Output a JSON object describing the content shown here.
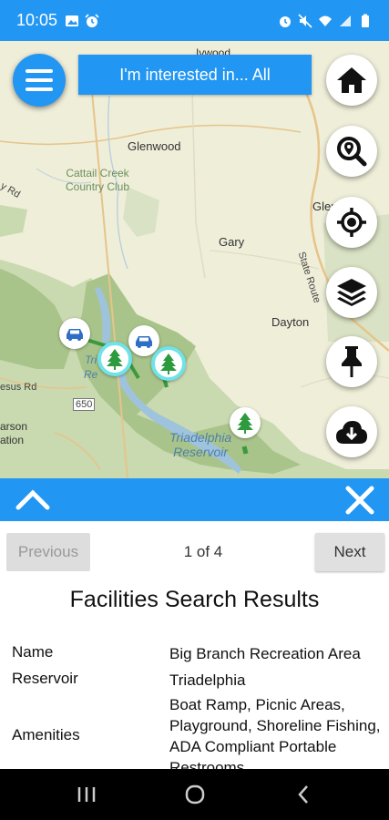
{
  "status_bar": {
    "time": "10:05",
    "left_icons": [
      "image-icon",
      "alarm-icon"
    ],
    "right_icons": [
      "alarm-icon",
      "mute-icon",
      "wifi-icon",
      "signal-icon",
      "battery-icon"
    ]
  },
  "map": {
    "labels": {
      "ivwood": "Ivwood",
      "glenwood": "Glenwood",
      "cattail": "Cattail Creek\nCountry Club",
      "glenelg": "Glenelg",
      "gary": "Gary",
      "dayton": "Dayton",
      "state_route": "State Route",
      "rd_left": "y Rd",
      "rd_left2": "esus Rd",
      "arson": "arson\nation",
      "route650": "650",
      "tri_partial": "Tri\nRe",
      "triadelphia": "Triadelphia\nReservoir"
    }
  },
  "interest_button": "I'm interested in... All",
  "fabs": [
    "home-icon",
    "search-location-icon",
    "crosshair-icon",
    "layers-icon",
    "pin-icon",
    "cloud-download-icon"
  ],
  "panel": {
    "previous": "Previous",
    "pager": "1 of 4",
    "next": "Next",
    "title": "Facilities Search Results",
    "rows": [
      {
        "label": "Name",
        "value": "Big Branch Recreation Area"
      },
      {
        "label": "Reservoir",
        "value": "Triadelphia"
      },
      {
        "label": "Amenities",
        "value": "Boat Ramp, Picnic Areas, Playground, Shoreline Fishing, ADA Compliant Portable Restrooms"
      }
    ]
  },
  "colors": {
    "primary": "#2196F3",
    "map_bg": "#efeed9",
    "park_green": "#a9c48a",
    "water": "#9fc3dd",
    "selection_ring": "#6fe3e8"
  }
}
